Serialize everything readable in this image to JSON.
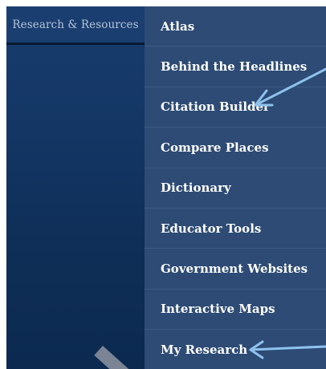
{
  "left_panel": {
    "header_label": "Research & Resources"
  },
  "menu": {
    "items": [
      {
        "label": "Atlas"
      },
      {
        "label": "Behind the Headlines"
      },
      {
        "label": "Citation Builder"
      },
      {
        "label": "Compare Places"
      },
      {
        "label": "Dictionary"
      },
      {
        "label": "Educator Tools"
      },
      {
        "label": "Government Websites"
      },
      {
        "label": "Interactive Maps"
      },
      {
        "label": "My Research"
      }
    ]
  },
  "colors": {
    "panel_blue": "#143766",
    "menu_blue": "#2d4b75",
    "arrow_blue": "#8ec2ee"
  }
}
